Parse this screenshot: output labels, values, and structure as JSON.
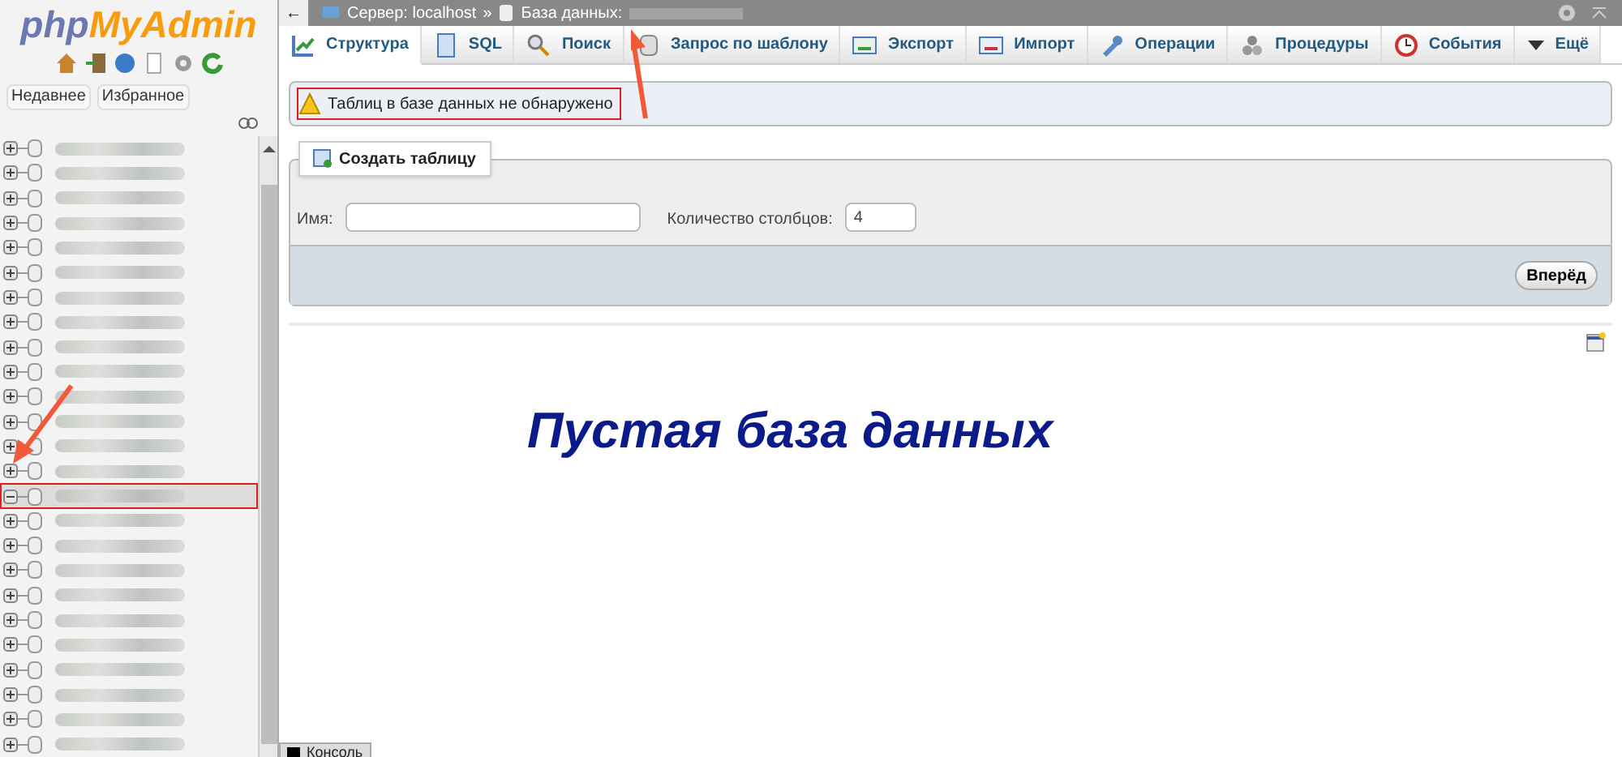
{
  "sidebar": {
    "logo_left": "php",
    "logo_right": "MyAdmin",
    "buttons": [
      {
        "label": "Недавнее"
      },
      {
        "label": "Избранное"
      }
    ],
    "databases": [
      {
        "expanded": false
      },
      {
        "expanded": false
      },
      {
        "expanded": false
      },
      {
        "expanded": false
      },
      {
        "expanded": false
      },
      {
        "expanded": false
      },
      {
        "expanded": false
      },
      {
        "expanded": false
      },
      {
        "expanded": false
      },
      {
        "expanded": false
      },
      {
        "expanded": false
      },
      {
        "expanded": false
      },
      {
        "expanded": false
      },
      {
        "expanded": false
      },
      {
        "expanded": true
      },
      {
        "expanded": false
      },
      {
        "expanded": false
      },
      {
        "expanded": false
      },
      {
        "expanded": false
      },
      {
        "expanded": false
      },
      {
        "expanded": false
      },
      {
        "expanded": false
      },
      {
        "expanded": false
      },
      {
        "expanded": false
      },
      {
        "expanded": false
      }
    ]
  },
  "breadcrumb": {
    "back": "←",
    "server": "Сервер: localhost",
    "separator": "»",
    "database": "База данных:"
  },
  "tabs": [
    {
      "label": "Структура",
      "selected": true,
      "kind": "structure"
    },
    {
      "label": "SQL",
      "selected": false,
      "kind": "sql"
    },
    {
      "label": "Поиск",
      "selected": false,
      "kind": "search"
    },
    {
      "label": "Запрос по шаблону",
      "selected": false,
      "kind": "query"
    },
    {
      "label": "Экспорт",
      "selected": false,
      "kind": "export"
    },
    {
      "label": "Импорт",
      "selected": false,
      "kind": "import"
    },
    {
      "label": "Операции",
      "selected": false,
      "kind": "operations"
    },
    {
      "label": "Процедуры",
      "selected": false,
      "kind": "routines"
    },
    {
      "label": "События",
      "selected": false,
      "kind": "events"
    },
    {
      "label": "Ещё",
      "selected": false,
      "kind": "more"
    }
  ],
  "notice": "Таблиц в базе данных не обнаружено",
  "create_table": {
    "legend": "Создать таблицу",
    "name_label": "Имя:",
    "columns_label": "Количество столбцов:",
    "columns_value": "4",
    "submit": "Вперёд"
  },
  "caption": "Пустая база данных",
  "console": "Консоль"
}
